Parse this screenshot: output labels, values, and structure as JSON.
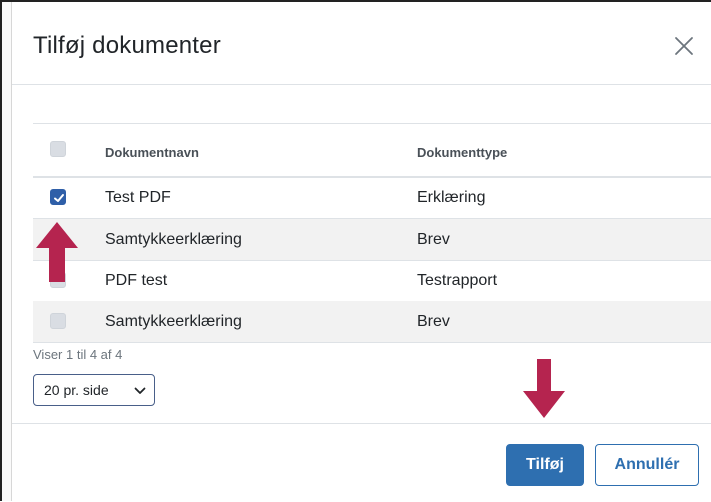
{
  "dialog": {
    "title": "Tilføj dokumenter"
  },
  "table": {
    "headers": {
      "name": "Dokumentnavn",
      "type": "Dokumenttype"
    },
    "rows": [
      {
        "name": "Test PDF",
        "type": "Erklæring",
        "checked": true
      },
      {
        "name": "Samtykkeerklæring",
        "type": "Brev",
        "checked": false
      },
      {
        "name": "PDF test",
        "type": "Testrapport",
        "checked": false
      },
      {
        "name": "Samtykkeerklæring",
        "type": "Brev",
        "checked": false
      }
    ]
  },
  "pagination": {
    "info": "Viser 1 til 4 af 4",
    "page_size_selected": "20 pr. side"
  },
  "footer": {
    "add_label": "Tilføj",
    "cancel_label": "Annullér"
  },
  "colors": {
    "primary": "#2e6fb0",
    "checkbox_checked": "#2f5fa8",
    "annotation_arrow": "#b5244f"
  },
  "icons": {
    "close": "close-icon",
    "checkmark": "checkmark-icon",
    "select_chevron": "chevron-down-icon",
    "annotation": "arrow-icon"
  }
}
